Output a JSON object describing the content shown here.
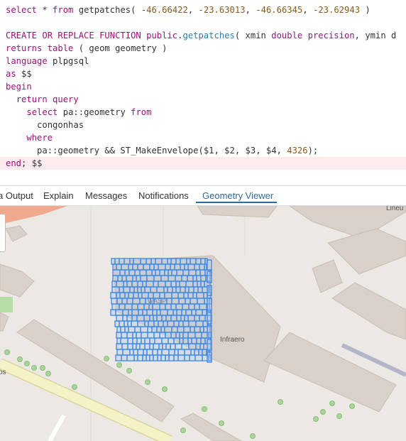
{
  "editor": {
    "lines": [
      [
        {
          "t": "select",
          "c": "kw"
        },
        {
          "t": " * "
        },
        {
          "t": "from",
          "c": "kw"
        },
        {
          "t": " getpatches( "
        },
        {
          "t": "-46.66422",
          "c": "num"
        },
        {
          "t": ", "
        },
        {
          "t": "-23.63013",
          "c": "num"
        },
        {
          "t": ", "
        },
        {
          "t": "-46.66345",
          "c": "num"
        },
        {
          "t": ", "
        },
        {
          "t": "-23.62943",
          "c": "num"
        },
        {
          "t": " )"
        }
      ],
      [],
      [
        {
          "t": "CREATE OR REPLACE FUNCTION",
          "c": "kw"
        },
        {
          "t": " "
        },
        {
          "t": "public",
          "c": "kw"
        },
        {
          "t": "."
        },
        {
          "t": "getpatches",
          "c": "fn"
        },
        {
          "t": "( xmin "
        },
        {
          "t": "double precision",
          "c": "ty"
        },
        {
          "t": ", ymin d"
        }
      ],
      [
        {
          "t": "returns table",
          "c": "kw"
        },
        {
          "t": " ( geom geometry )"
        }
      ],
      [
        {
          "t": "language",
          "c": "kw"
        },
        {
          "t": " plpgsql"
        }
      ],
      [
        {
          "t": "as",
          "c": "kw"
        },
        {
          "t": " $$"
        }
      ],
      [
        {
          "t": "begin",
          "c": "kw"
        }
      ],
      [
        {
          "t": "  "
        },
        {
          "t": "return query",
          "c": "kw"
        }
      ],
      [
        {
          "t": "    "
        },
        {
          "t": "select",
          "c": "kw"
        },
        {
          "t": " pa::geometry "
        },
        {
          "t": "from",
          "c": "kw"
        }
      ],
      [
        {
          "t": "      congonhas"
        }
      ],
      [
        {
          "t": "    "
        },
        {
          "t": "where",
          "c": "kw"
        }
      ],
      [
        {
          "t": "      pa::geometry && ST_MakeEnvelope($1, $2, $3, $4, "
        },
        {
          "t": "4326",
          "c": "num"
        },
        {
          "t": ");"
        }
      ],
      [
        {
          "t": "end",
          "c": "kw"
        },
        {
          "t": "; $$"
        }
      ]
    ],
    "highlighted_line": 12
  },
  "tabs": {
    "data_output": "a Output",
    "explain": "Explain",
    "messages": "Messages",
    "notifications": "Notifications",
    "geometry_viewer": "Geometry Viewer",
    "active": "geometry_viewer"
  },
  "map": {
    "labels": {
      "top_right": "Lineu",
      "infraero": "Infraero",
      "bottom_left": "os",
      "patch_label": "WASP"
    },
    "colors": {
      "background": "#ece9e4",
      "building": "#d9d0c9",
      "building_stroke": "#c9beb5",
      "road": "#ffffff",
      "main_road": "#f5f3c6",
      "main_road_edge": "#d9d4a0",
      "orange_road": "#f0a88e",
      "tram": "#b5b5c9",
      "park": "#b7dda6",
      "tree": "#a9d39a",
      "tree_stroke": "#8cbf7c",
      "geometry_stroke": "#3a86e6",
      "geometry_fill": "#a9c8ee"
    }
  },
  "icons": {
    "zoom_control": "zoom-control-icon"
  }
}
